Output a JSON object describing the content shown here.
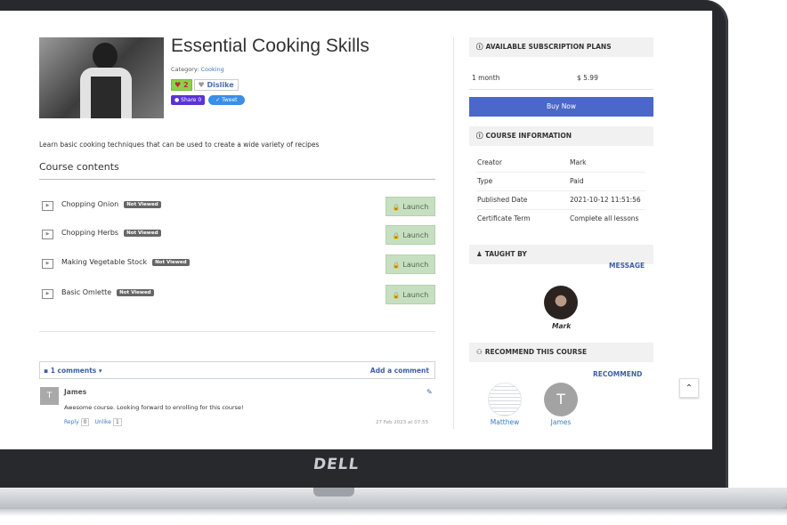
{
  "device": {
    "brand": "DELL"
  },
  "course": {
    "title": "Essential Cooking Skills",
    "category_label": "Category:",
    "category": "Cooking",
    "likes": "2",
    "dislike_label": "Dislike",
    "share_label": "Share 0",
    "tweet_label": "Tweet",
    "description": "Learn basic cooking techniques that can be used to create a wide variety of recipes"
  },
  "contents": {
    "heading": "Course contents",
    "lessons": [
      {
        "name": "Chopping Onion",
        "status": "Not Viewed",
        "action": "Launch"
      },
      {
        "name": "Chopping Herbs",
        "status": "Not Viewed",
        "action": "Launch"
      },
      {
        "name": "Making Vegetable Stock",
        "status": "Not Viewed",
        "action": "Launch"
      },
      {
        "name": "Basic Omlette",
        "status": "Not Viewed",
        "action": "Launch"
      }
    ]
  },
  "comments": {
    "count_label": "1 comments",
    "add_label": "Add a comment",
    "items": [
      {
        "initial": "T",
        "author": "James",
        "text": "Awesome course. Looking forward to enrolling for this course!",
        "reply_label": "Reply",
        "reply_count": "0",
        "unlike_label": "Unlike",
        "unlike_count": "1",
        "date": "27 Feb 2023 at 07:55"
      }
    ]
  },
  "sidebar": {
    "plans": {
      "heading": "AVAILABLE SUBSCRIPTION PLANS",
      "rows": [
        {
          "duration": "1 month",
          "price": "$ 5.99"
        }
      ],
      "buy_label": "Buy Now"
    },
    "info": {
      "heading": "COURSE INFORMATION",
      "rows": [
        {
          "key": "Creator",
          "value": "Mark"
        },
        {
          "key": "Type",
          "value": "Paid"
        },
        {
          "key": "Published Date",
          "value": "2021-10-12 11:51:56"
        },
        {
          "key": "Certificate Term",
          "value": "Complete all lessons"
        }
      ]
    },
    "taught_by": {
      "heading": "TAUGHT BY",
      "message_label": "MESSAGE",
      "teacher": "Mark"
    },
    "recommend": {
      "heading": "RECOMMEND THIS COURSE",
      "link_label": "RECOMMEND",
      "users": [
        {
          "name": "Matthew",
          "initial": ""
        },
        {
          "name": "James",
          "initial": "T"
        }
      ]
    }
  },
  "colors": {
    "accent": "#4a67c9",
    "launch_bg": "#c7dfc1",
    "link": "#3b5fa5"
  }
}
